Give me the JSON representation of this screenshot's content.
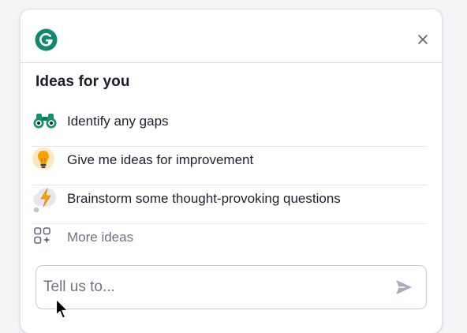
{
  "header": {
    "logo_icon": "grammarly-g-icon",
    "close_icon": "close-icon"
  },
  "section": {
    "title": "Ideas for you"
  },
  "ideas": [
    {
      "label": "Identify any gaps",
      "icon": "binoculars-icon"
    },
    {
      "label": "Give me ideas for improvement",
      "icon": "lightbulb-icon"
    },
    {
      "label": "Brainstorm some thought-provoking questions",
      "icon": "lightning-cloud-icon"
    },
    {
      "label": "More ideas",
      "icon": "grid-sparkle-icon"
    }
  ],
  "prompt": {
    "placeholder": "Tell us to...",
    "value": "",
    "send_icon": "send-icon"
  },
  "colors": {
    "brand": "#0e8a6e",
    "border": "#d9dbe3",
    "muted_text": "#6d7287"
  }
}
